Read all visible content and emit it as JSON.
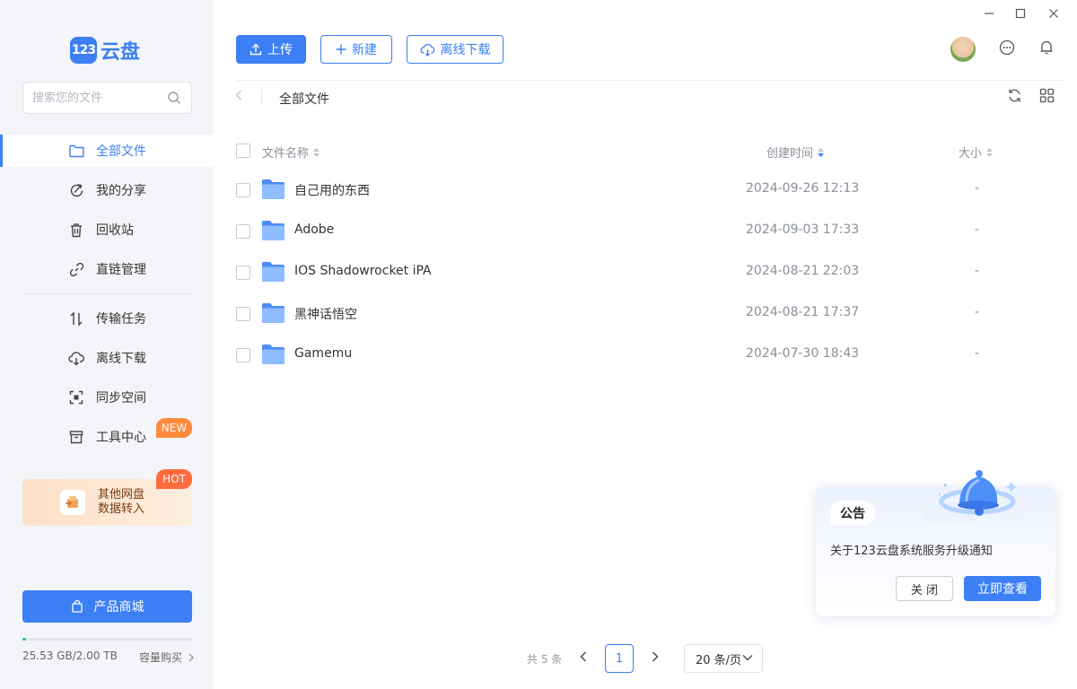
{
  "app": {
    "logo_text": "云盘",
    "logo_badge": "123"
  },
  "search": {
    "placeholder": "搜索您的文件"
  },
  "sidebar": {
    "items": [
      {
        "label": "全部文件",
        "icon": "folder-icon",
        "active": true
      },
      {
        "label": "我的分享",
        "icon": "share-icon"
      },
      {
        "label": "回收站",
        "icon": "trash-icon"
      },
      {
        "label": "直链管理",
        "icon": "link-icon"
      },
      {
        "label": "传输任务",
        "icon": "transfer-icon"
      },
      {
        "label": "离线下载",
        "icon": "cloud-download-icon"
      },
      {
        "label": "同步空间",
        "icon": "sync-space-icon"
      },
      {
        "label": "工具中心",
        "icon": "toolbox-icon"
      }
    ],
    "new_badge": "NEW",
    "promo": {
      "line1": "其他网盘",
      "line2": "数据转入",
      "badge": "HOT"
    },
    "shop_button": "产品商城",
    "storage": {
      "used": "25.53 GB/2.00 TB",
      "fraction_used": 0.0125
    },
    "buy_capacity": "容量购买"
  },
  "toolbar": {
    "upload": "上传",
    "new": "新建",
    "offline_download": "离线下载"
  },
  "breadcrumb": {
    "current": "全部文件"
  },
  "table": {
    "headers": {
      "name": "文件名称",
      "created": "创建时间",
      "size": "大小"
    },
    "rows": [
      {
        "name": "自己用的东西",
        "created": "2024-09-26 12:13",
        "size": "-"
      },
      {
        "name": "Adobe",
        "created": "2024-09-03 17:33",
        "size": "-"
      },
      {
        "name": "IOS Shadowrocket iPA",
        "created": "2024-08-21 22:03",
        "size": "-"
      },
      {
        "name": "黑神话悟空",
        "created": "2024-08-21 17:37",
        "size": "-"
      },
      {
        "name": "Gamemu",
        "created": "2024-07-30 18:43",
        "size": "-"
      }
    ]
  },
  "pagination": {
    "total": "共 5 条",
    "current_page": "1",
    "page_size": "20 条/页"
  },
  "notice": {
    "tag": "公告",
    "message": "关于123云盘系统服务升级通知",
    "close": "关 闭",
    "view": "立即查看"
  },
  "colors": {
    "accent": "#3d7ff5",
    "sidebar_bg": "#f3f5f8",
    "new_badge": "#ff8a3c",
    "hot_badge": "#ff6b3d",
    "storage": "#34c38f"
  }
}
